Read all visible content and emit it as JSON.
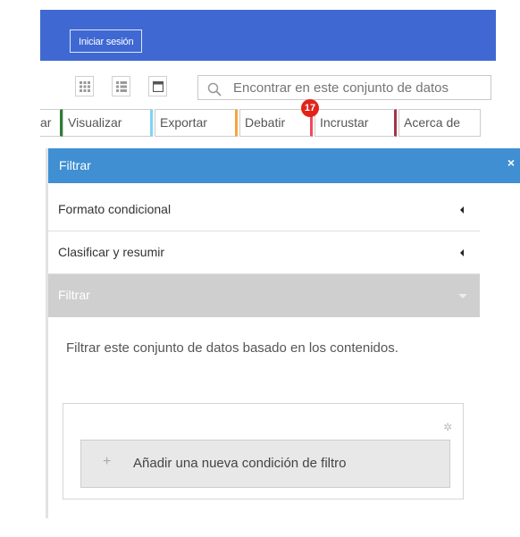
{
  "header": {
    "login_label": "Iniciar sesión"
  },
  "toolbar": {
    "view_icons": [
      "grid-view-icon",
      "list-view-icon",
      "table-view-icon"
    ],
    "search_placeholder": "Encontrar en este conjunto de datos"
  },
  "tabs": [
    {
      "label": "ar",
      "accent": "#2e7d32"
    },
    {
      "label": "Visualizar",
      "accent": "#7fd3f5"
    },
    {
      "label": "Exportar",
      "accent": "#f7a440"
    },
    {
      "label": "Debatir",
      "accent": "#f1485a"
    },
    {
      "label": "Incrustar",
      "accent": "#a23448"
    },
    {
      "label": "Acerca de",
      "accent": "#cccccc"
    }
  ],
  "discuss_badge": "17",
  "panel": {
    "title": "Filtrar",
    "close": "×",
    "sections": [
      {
        "label": "Formato condicional"
      },
      {
        "label": "Clasificar y resumir"
      },
      {
        "label": "Filtrar"
      }
    ],
    "description": "Filtrar este conjunto de datos basado en los contenidos.",
    "add_condition_label": "Añadir una nueva condición de filtro",
    "add_icon": "+",
    "gear_icon": "✲"
  },
  "colors": {
    "header_blue": "#3f68d2",
    "panel_header": "#3f8fd2",
    "active_section": "#cfcfcf",
    "badge": "#e2231a"
  }
}
